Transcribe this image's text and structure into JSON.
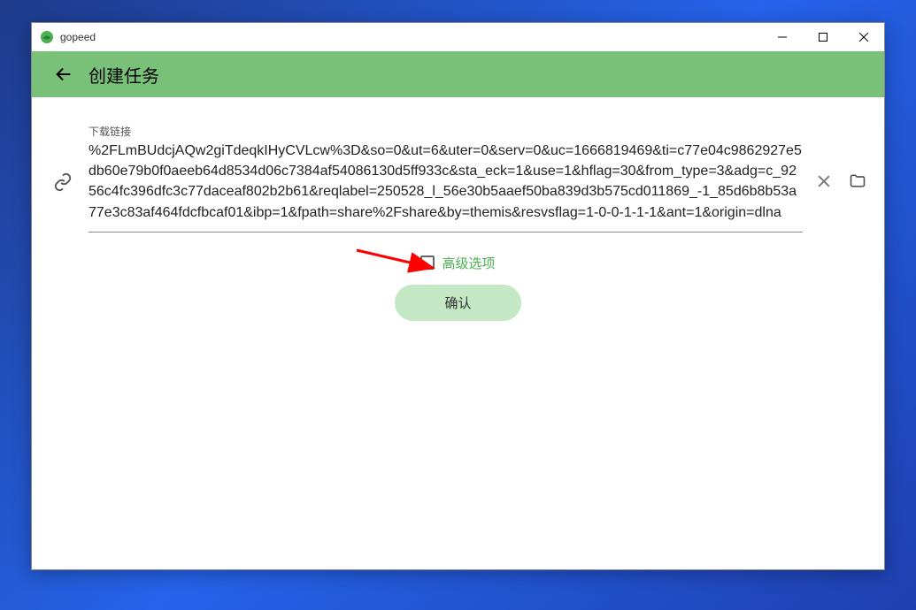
{
  "titlebar": {
    "app_name": "gopeed"
  },
  "header": {
    "title": "创建任务"
  },
  "form": {
    "url_label": "下载链接",
    "url_value": "%2FLmBUdcjAQw2giTdeqkIHyCVLcw%3D&so=0&ut=6&uter=0&serv=0&uc=1666819469&ti=c77e04c9862927e5db60e79b0f0aeeb64d8534d06c7384af54086130d5ff933c&sta_eck=1&use=1&hflag=30&from_type=3&adg=c_9256c4fc396dfc3c77daceaf802b2b61&reqlabel=250528_l_56e30b5aaef50ba839d3b575cd011869_-1_85d6b8b53a77e3c83af464fdcfbcaf01&ibp=1&fpath=share%2Fshare&by=themis&resvsflag=1-0-0-1-1-1&ant=1&origin=dlna",
    "advanced_label": "高级选项",
    "confirm_label": "确认"
  }
}
